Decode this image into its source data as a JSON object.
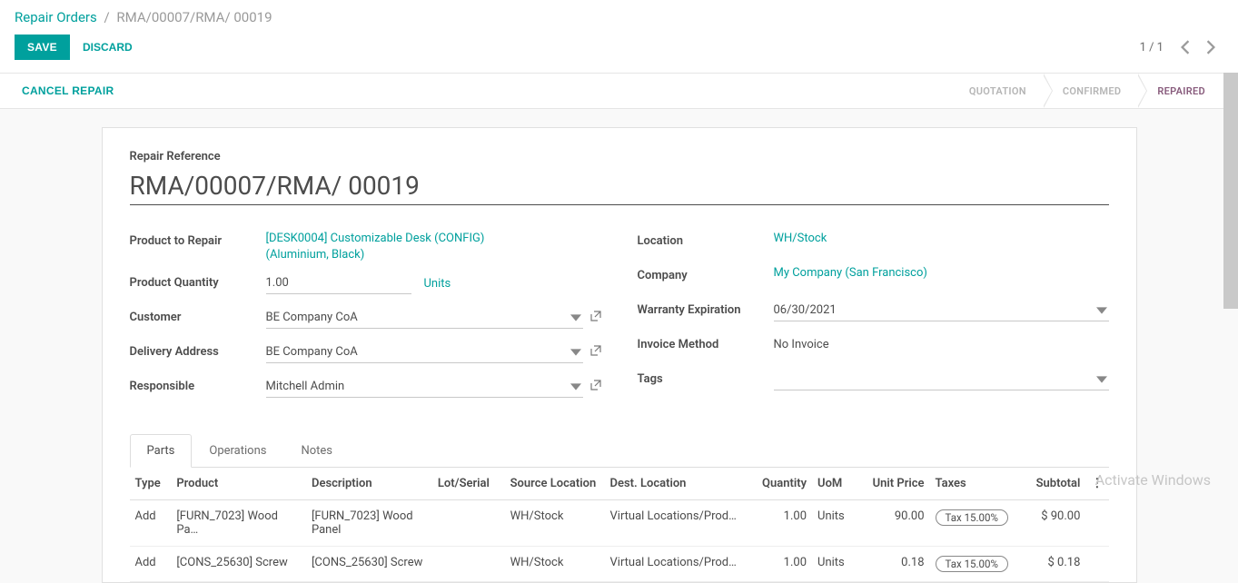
{
  "breadcrumb": {
    "root": "Repair Orders",
    "sep": "/",
    "current": "RMA/00007/RMA/ 00019"
  },
  "toolbar": {
    "save": "SAVE",
    "discard": "DISCARD",
    "pager": "1 / 1"
  },
  "actions": {
    "cancel_repair": "CANCEL REPAIR"
  },
  "steps": {
    "quotation": "QUOTATION",
    "confirmed": "CONFIRMED",
    "repaired": "REPAIRED"
  },
  "form": {
    "ref_label": "Repair Reference",
    "ref_value": "RMA/00007/RMA/ 00019",
    "left": {
      "product_label": "Product to Repair",
      "product_value": "[DESK0004] Customizable Desk (CONFIG) (Aluminium, Black)",
      "qty_label": "Product Quantity",
      "qty_value": "1.00",
      "qty_unit": "Units",
      "customer_label": "Customer",
      "customer_value": "BE Company CoA",
      "delivery_label": "Delivery Address",
      "delivery_value": "BE Company CoA",
      "responsible_label": "Responsible",
      "responsible_value": "Mitchell Admin"
    },
    "right": {
      "location_label": "Location",
      "location_value": "WH/Stock",
      "company_label": "Company",
      "company_value": "My Company (San Francisco)",
      "warranty_label": "Warranty Expiration",
      "warranty_value": "06/30/2021",
      "invoice_label": "Invoice Method",
      "invoice_value": "No Invoice",
      "tags_label": "Tags",
      "tags_value": ""
    }
  },
  "tabs": {
    "parts": "Parts",
    "operations": "Operations",
    "notes": "Notes"
  },
  "table": {
    "headers": {
      "type": "Type",
      "product": "Product",
      "description": "Description",
      "lot": "Lot/Serial",
      "src": "Source Location",
      "dest": "Dest. Location",
      "qty": "Quantity",
      "uom": "UoM",
      "price": "Unit Price",
      "taxes": "Taxes",
      "subtotal": "Subtotal"
    },
    "rows": [
      {
        "type": "Add",
        "product": "[FURN_7023] Wood Pa…",
        "description": "[FURN_7023] Wood Panel",
        "lot": "",
        "src": "WH/Stock",
        "dest": "Virtual Locations/Prod…",
        "qty": "1.00",
        "uom": "Units",
        "price": "90.00",
        "tax": "Tax 15.00%",
        "subtotal": "$ 90.00"
      },
      {
        "type": "Add",
        "product": "[CONS_25630] Screw",
        "description": "[CONS_25630] Screw",
        "lot": "",
        "src": "WH/Stock",
        "dest": "Virtual Locations/Prod…",
        "qty": "1.00",
        "uom": "Units",
        "price": "0.18",
        "tax": "Tax 15.00%",
        "subtotal": "$ 0.18"
      }
    ]
  },
  "watermark": "Activate Windows"
}
